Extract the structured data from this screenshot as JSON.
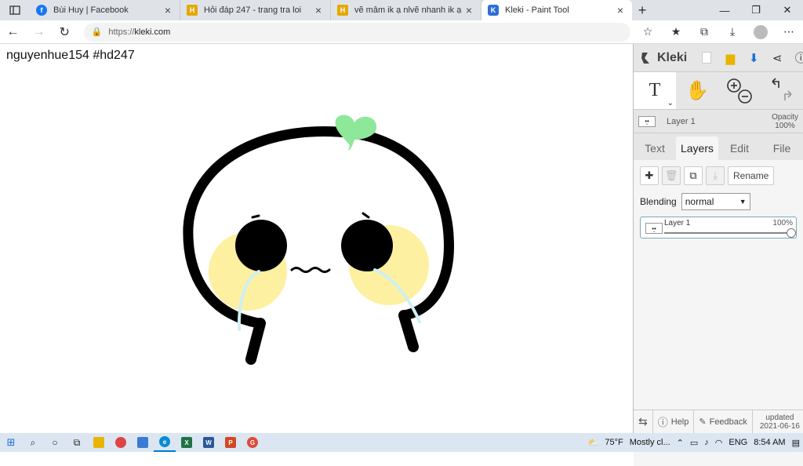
{
  "browser": {
    "tabs": [
      {
        "title": "Bùi Huy | Facebook",
        "favicon": "facebook-icon",
        "color": "#1877f2",
        "glyph": "f"
      },
      {
        "title": "Hỏi đáp 247 - trang tra loi",
        "favicon": "hoidap-icon",
        "color": "#e6a700",
        "glyph": "H"
      },
      {
        "title": "vẽ mâm ik ạ nlvẽ nhanh ik ạ để",
        "favicon": "hoidap-icon",
        "color": "#e6a700",
        "glyph": "H"
      },
      {
        "title": "Kleki - Paint Tool",
        "favicon": "kleki-icon",
        "color": "#2d6fd6",
        "glyph": "K"
      }
    ],
    "url_protocol": "https://",
    "url_host": "kleki.com"
  },
  "canvas": {
    "caption": "nguyenhue154 #hd247"
  },
  "kleki": {
    "logo": "Kleki",
    "layer_name": "Layer 1",
    "opacity_label": "Opacity",
    "opacity_value": "100%",
    "tabs": [
      "Text",
      "Layers",
      "Edit",
      "File"
    ],
    "rename_label": "Rename",
    "blending_label": "Blending",
    "blending_value": "normal",
    "layer_row": {
      "name": "Layer 1",
      "opacity": "100%",
      "opacity_fraction": 1.0
    },
    "help_label": "Help",
    "feedback_label": "Feedback",
    "updated_label": "updated",
    "updated_date": "2021-06-16"
  },
  "taskbar": {
    "temperature": "75°F",
    "weather": "Mostly cl...",
    "language": "ENG",
    "time": "8:54 AM"
  },
  "colors": {
    "sprout": "#8ee89a",
    "cheek": "#fdf0a0",
    "tear": "#cfeff5",
    "accent": "#0078d4"
  }
}
